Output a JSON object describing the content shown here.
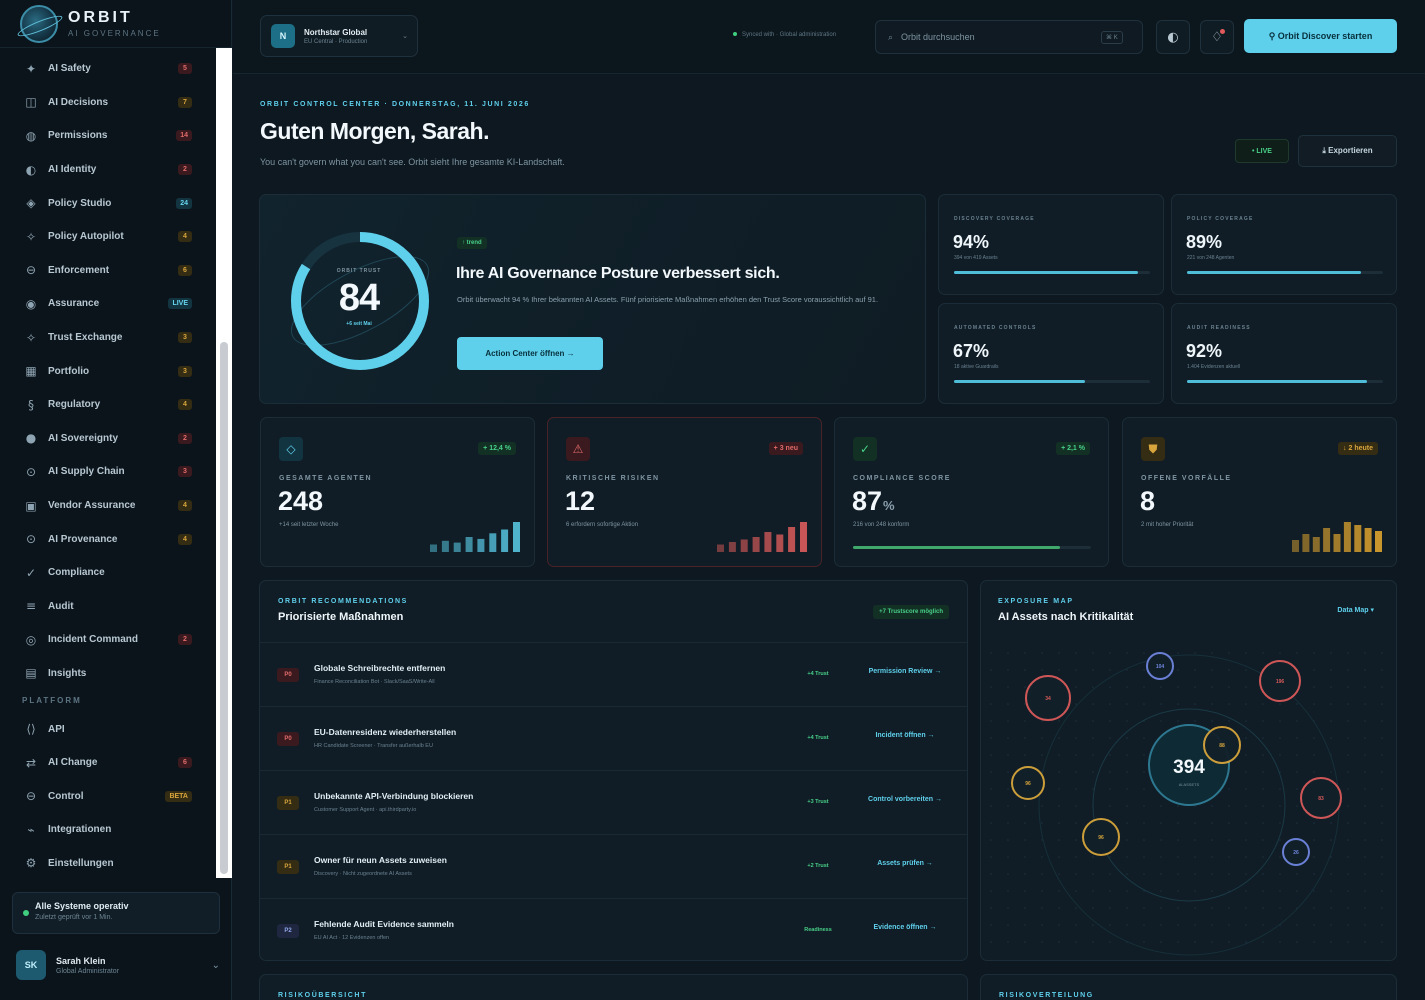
{
  "brand": {
    "name": "ORBIT",
    "sub": "AI GOVERNANCE"
  },
  "sidebar": {
    "items": [
      {
        "icon": "sparkle-icon",
        "glyph": "✦",
        "label": "AI Safety",
        "badge": "5",
        "badge_style": "red"
      },
      {
        "icon": "grid-icon",
        "glyph": "◫",
        "label": "AI Decisions",
        "badge": "7",
        "badge_style": "amber"
      },
      {
        "icon": "lock-icon",
        "glyph": "◍",
        "label": "Permissions",
        "badge": "14",
        "badge_style": "red"
      },
      {
        "icon": "identity-icon",
        "glyph": "◐",
        "label": "AI Identity",
        "badge": "2",
        "badge_style": "red"
      },
      {
        "icon": "policy-icon",
        "glyph": "◈",
        "label": "Policy Studio",
        "badge": "24",
        "badge_style": "cyan"
      },
      {
        "icon": "autopilot-icon",
        "glyph": "✧",
        "label": "Policy Autopilot",
        "badge": "4",
        "badge_style": "amber"
      },
      {
        "icon": "enforcement-icon",
        "glyph": "⊖",
        "label": "Enforcement",
        "badge": "6",
        "badge_style": "amber"
      },
      {
        "icon": "assurance-icon",
        "glyph": "◉",
        "label": "Assurance",
        "badge": "LIVE",
        "badge_style": "cyan"
      },
      {
        "icon": "exchange-icon",
        "glyph": "✧",
        "label": "Trust Exchange",
        "badge": "3",
        "badge_style": "amber"
      },
      {
        "icon": "portfolio-icon",
        "glyph": "▦",
        "label": "Portfolio",
        "badge": "3",
        "badge_style": "amber"
      },
      {
        "icon": "regulatory-icon",
        "glyph": "§",
        "label": "Regulatory",
        "badge": "4",
        "badge_style": "amber"
      },
      {
        "icon": "sovereignty-icon",
        "glyph": "●",
        "label": "AI Sovereignty",
        "badge": "2",
        "badge_style": "red"
      },
      {
        "icon": "supply-chain-icon",
        "glyph": "⊙",
        "label": "AI Supply Chain",
        "badge": "3",
        "badge_style": "red"
      },
      {
        "icon": "vendor-icon",
        "glyph": "▣",
        "label": "Vendor Assurance",
        "badge": "4",
        "badge_style": "amber"
      },
      {
        "icon": "provenance-icon",
        "glyph": "⊙",
        "label": "AI Provenance",
        "badge": "4",
        "badge_style": "amber"
      },
      {
        "icon": "check-icon",
        "glyph": "✓",
        "label": "Compliance",
        "badge": "",
        "badge_style": ""
      },
      {
        "icon": "audit-icon",
        "glyph": "≡",
        "label": "Audit",
        "badge": "",
        "badge_style": ""
      },
      {
        "icon": "incident-icon",
        "glyph": "◎",
        "label": "Incident Command",
        "badge": "2",
        "badge_style": "red"
      },
      {
        "icon": "insights-icon",
        "glyph": "▤",
        "label": "Insights",
        "badge": "",
        "badge_style": ""
      }
    ],
    "platform_label": "PLATFORM",
    "platform_items": [
      {
        "icon": "api-icon",
        "glyph": "⟨⟩",
        "label": "API",
        "badge": "",
        "badge_style": ""
      },
      {
        "icon": "change-icon",
        "glyph": "⇄",
        "label": "AI Change",
        "badge": "6",
        "badge_style": "red"
      },
      {
        "icon": "control-icon",
        "glyph": "⊖",
        "label": "Control",
        "badge": "BETA",
        "badge_style": "amber"
      },
      {
        "icon": "integrations-icon",
        "glyph": "⌁",
        "label": "Integrationen",
        "badge": "",
        "badge_style": ""
      },
      {
        "icon": "settings-icon",
        "glyph": "⚙",
        "label": "Einstellungen",
        "badge": "",
        "badge_style": ""
      }
    ],
    "status_title": "Alle Systeme operativ",
    "status_sub": "Zuletzt geprüft vor 1 Min.",
    "user_initials": "SK",
    "user_name": "Sarah Klein",
    "user_role": "Global Administrator"
  },
  "topbar": {
    "org_initial": "N",
    "org_name": "Northstar Global",
    "org_sub": "EU Central · Production",
    "sync_text": "Synced with · Global administration",
    "search_placeholder": "Orbit durchsuchen",
    "search_shortcut": "⌘ K",
    "cta_label": "⚲ Orbit Discover starten"
  },
  "header": {
    "eyebrow": "ORBIT CONTROL CENTER · DONNERSTAG, 11. JUNI 2026",
    "greeting": "Guten Morgen, Sarah.",
    "subtitle": "You can't govern what you can't see. Orbit sieht Ihre gesamte KI-Landschaft.",
    "live_label": "• LIVE",
    "export_label": "⤓ Exportieren"
  },
  "hero": {
    "ring_eyebrow": "ORBIT TRUST",
    "score": "84",
    "score_fraction": 0.84,
    "ring_delta": "+6 seit Mai",
    "tag": "↑ trend",
    "title": "Ihre AI Governance Posture verbessert sich.",
    "text": "Orbit überwacht 94 % Ihrer bekannten AI Assets. Fünf priorisierte Maßnahmen erhöhen den Trust Score voraussichtlich auf 91.",
    "button": "Action Center öffnen →"
  },
  "minis": [
    {
      "label": "DISCOVERY COVERAGE",
      "value": "94%",
      "sub": "394 von 419 Assets",
      "fraction": 0.94
    },
    {
      "label": "POLICY COVERAGE",
      "value": "89%",
      "sub": "221 von 248 Agenten",
      "fraction": 0.89
    },
    {
      "label": "AUTOMATED CONTROLS",
      "value": "67%",
      "sub": "18 aktive Guardrails",
      "fraction": 0.67
    },
    {
      "label": "AUDIT READINESS",
      "value": "92%",
      "sub": "1.404 Evidenzen aktuell",
      "fraction": 0.92
    }
  ],
  "kpis": [
    {
      "icon": "diamond-icon",
      "glyph": "◇",
      "delta": "+ 12,4 %",
      "label": "GESAMTE AGENTEN",
      "value": "248",
      "unit": "",
      "sub": "+14 seit letzter Woche",
      "tone": "cyan",
      "bars": [
        4,
        6,
        5,
        8,
        7,
        10,
        12,
        16
      ]
    },
    {
      "icon": "warning-icon",
      "glyph": "⚠",
      "delta": "+ 3 neu",
      "label": "KRITISCHE RISIKEN",
      "value": "12",
      "unit": "",
      "sub": "6 erfordern sofortige Aktion",
      "tone": "red",
      "bars": [
        3,
        4,
        5,
        6,
        8,
        7,
        10,
        12
      ]
    },
    {
      "icon": "check-icon",
      "glyph": "✓",
      "delta": "+ 2,1 %",
      "label": "COMPLIANCE SCORE",
      "value": "87",
      "unit": "%",
      "sub": "216 von 248 konform",
      "tone": "green",
      "progress": 0.87
    },
    {
      "icon": "shield-icon",
      "glyph": "⛊",
      "delta": "↓ 2 heute",
      "label": "OFFENE VORFÄLLE",
      "value": "8",
      "unit": "",
      "sub": "2 mit hoher Priorität",
      "tone": "amber",
      "bars": [
        4,
        6,
        5,
        8,
        6,
        10,
        9,
        8,
        7
      ]
    }
  ],
  "reco": {
    "eyebrow": "ORBIT RECOMMENDATIONS",
    "title": "Priorisierte Maßnahmen",
    "pill": "+7 Trustscore möglich",
    "rows": [
      {
        "prio": "P0",
        "cls": "p0",
        "name": "Globale Schreibrechte entfernen",
        "meta": "Finance Reconciliation Bot · Slack/SaaS/Write-All",
        "impact": "+4 Trust",
        "action": "Permission Review →"
      },
      {
        "prio": "P0",
        "cls": "p0",
        "name": "EU-Datenresidenz wiederherstellen",
        "meta": "HR Candidate Screener · Transfer außerhalb EU",
        "impact": "+4 Trust",
        "action": "Incident öffnen →"
      },
      {
        "prio": "P1",
        "cls": "p1",
        "name": "Unbekannte API-Verbindung blockieren",
        "meta": "Customer Support Agent · api.thirdparty.io",
        "impact": "+3 Trust",
        "action": "Control vorbereiten →"
      },
      {
        "prio": "P1",
        "cls": "p1",
        "name": "Owner für neun Assets zuweisen",
        "meta": "Discovery · Nicht zugeordnete AI Assets",
        "impact": "+2 Trust",
        "action": "Assets prüfen →"
      },
      {
        "prio": "P2",
        "cls": "p2",
        "name": "Fehlende Audit Evidence sammeln",
        "meta": "EU AI Act · 12 Evidenzen offen",
        "impact": "Readiness",
        "action": "Evidence öffnen →"
      }
    ]
  },
  "emap": {
    "eyebrow": "EXPOSURE MAP",
    "title": "AI Assets nach Kritikalität",
    "link": "Data Map ▾",
    "total": "394",
    "total_label": "AI ASSETS",
    "nodes": [
      {
        "label": "34",
        "tone": "red"
      },
      {
        "label": "104",
        "tone": "blue"
      },
      {
        "label": "196",
        "tone": "red"
      },
      {
        "label": "88",
        "tone": "amber"
      },
      {
        "label": "96",
        "tone": "amber"
      },
      {
        "label": "83",
        "tone": "red"
      },
      {
        "label": "96",
        "tone": "amber"
      },
      {
        "label": "26",
        "tone": "blue"
      }
    ]
  },
  "bottom": {
    "left_label": "RISIKOÜBERSICHT",
    "right_label": "RISIKOVERTEILUNG"
  }
}
